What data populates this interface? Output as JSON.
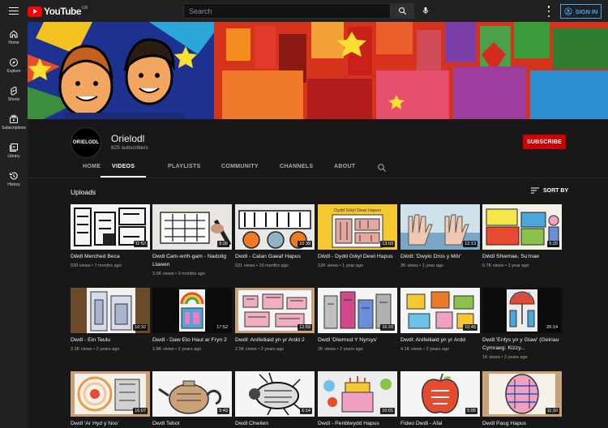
{
  "topbar": {
    "logo_text": "YouTube",
    "logo_region": "GB",
    "search_placeholder": "Search",
    "signin_label": "SIGN IN",
    "icons": [
      "menu-icon",
      "search-icon",
      "mic-icon",
      "more-vert-icon",
      "account-icon"
    ]
  },
  "sidebar": {
    "items": [
      {
        "label": "Home",
        "icon": "home-icon"
      },
      {
        "label": "Explore",
        "icon": "compass-icon"
      },
      {
        "label": "Shorts",
        "icon": "shorts-icon"
      },
      {
        "label": "Subscriptions",
        "icon": "subscriptions-icon"
      },
      {
        "label": "Library",
        "icon": "library-icon"
      },
      {
        "label": "History",
        "icon": "history-icon"
      }
    ]
  },
  "channel": {
    "name": "Orielodl",
    "avatar_text": "ORIELODL",
    "subscribers": "825 subscribers",
    "subscribe_label": "SUBSCRIBE"
  },
  "tabs": [
    "HOME",
    "VIDEOS",
    "PLAYLISTS",
    "COMMUNITY",
    "CHANNELS",
    "ABOUT"
  ],
  "active_tab": "VIDEOS",
  "section": {
    "title": "Uploads",
    "sort_label": "SORT BY"
  },
  "videos": [
    {
      "title": "Dŵdl Merched Beca",
      "meta": "639 views • 7 months ago",
      "duration": "11:53"
    },
    {
      "title": "Dwdl Cam-wrth-gam - Nadolig Llawen",
      "meta": "3.5K views • 9 months ago",
      "duration": "9:28"
    },
    {
      "title": "Dwdl - Calan Gaeaf Hapus",
      "meta": "631 views • 10 months ago",
      "duration": "10:39"
    },
    {
      "title": "Dŵdl - Dydd Gŵyl Dewi Hapus",
      "meta": "12K views • 1 year ago",
      "duration": "13:03",
      "thumb_text": "Dydd Gŵyl Dewi Hapus"
    },
    {
      "title": "Dŵdl: 'Dwylo Dros y Môr'",
      "meta": "3K views • 1 year ago",
      "duration": "12:13"
    },
    {
      "title": "Dŵdl Shwmae, Su'mae",
      "meta": "6.7K views • 1 year ago",
      "duration": "5:20"
    },
    {
      "title": "Dwdl - Ein Teulu",
      "meta": "2.2K views • 2 years ago",
      "duration": "10:32"
    },
    {
      "title": "Dwdl - Daw Eto Haul ar Fryn 2",
      "meta": "3.8K views • 2 years ago",
      "duration": "17:52"
    },
    {
      "title": "Dwdl: Anifeiliaid yn yr Ardd 2",
      "meta": "2.5K views • 2 years ago",
      "duration": "12:59"
    },
    {
      "title": "Dwdl 'Diwrnod Y Nyrsys'",
      "meta": "2K views • 2 years ago",
      "duration": "16:20"
    },
    {
      "title": "Dwdl: Anifeiliaid yn yr Ardd",
      "meta": "4.1K views • 2 years ago",
      "duration": "10:45"
    },
    {
      "title": "Dwdl 'Enfys yn y Glaw' (Geiriau Cymraeg: Kizzy...",
      "meta": "1K views • 2 years ago",
      "duration": "26:14"
    },
    {
      "title": "Dwdl 'Ar Hyd y Nos'",
      "meta": "",
      "duration": "16:07"
    },
    {
      "title": "Dwdl Tebot",
      "meta": "",
      "duration": "5:43"
    },
    {
      "title": "Dwdl Chwilen",
      "meta": "",
      "duration": "6:14"
    },
    {
      "title": "Dwdl - Penblwydd Hapus",
      "meta": "",
      "duration": "10:01"
    },
    {
      "title": "Fideo Dwdl - Afal",
      "meta": "",
      "duration": "5:05"
    },
    {
      "title": "Dwdl Pasg Hapus",
      "meta": "",
      "duration": "11:10"
    }
  ],
  "colors": {
    "accent": "#ff0000",
    "subscribe": "#cc0000",
    "link": "#3ea6ff",
    "background": "#181818",
    "header": "#212121"
  }
}
